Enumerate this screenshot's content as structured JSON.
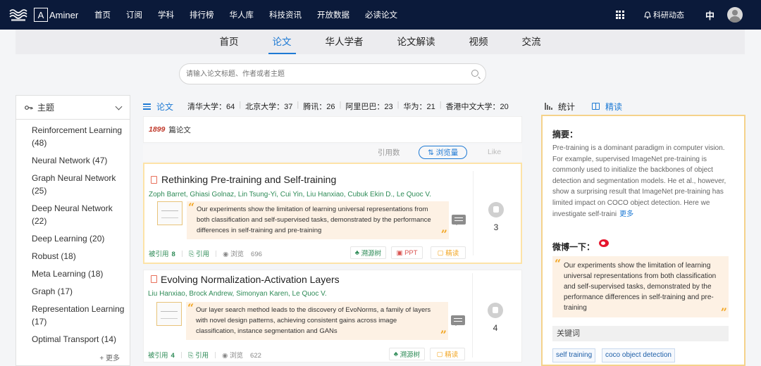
{
  "top": {
    "brand": "Aminer",
    "brand_letter": "A",
    "nav": [
      "首页",
      "订阅",
      "学科",
      "排行榜",
      "华人库",
      "科技资讯",
      "开放数据",
      "必读论文"
    ],
    "research_updates": "科研动态",
    "lang": "中"
  },
  "subnav": [
    "首页",
    "论文",
    "华人学者",
    "论文解读",
    "视频",
    "交流"
  ],
  "subnav_active": "论文",
  "search": {
    "placeholder": "请输入论文标题、作者或者主题"
  },
  "sidebar": {
    "header": "主题",
    "topics": [
      "Reinforcement Learning (48)",
      "Neural Network (47)",
      "Graph Neural Network (25)",
      "Deep Neural Network (22)",
      "Deep Learning (20)",
      "Robust (18)",
      "Meta Learning (18)",
      "Graph (17)",
      "Representation Learning (17)",
      "Optimal Transport (14)"
    ],
    "more": "+ 更多"
  },
  "center": {
    "tab": "论文",
    "institutions": [
      "清华大学：64",
      "北京大学：37",
      "腾讯：26",
      "阿里巴巴：23",
      "华为：21",
      "香港中文大学：20"
    ],
    "count_num": "1899",
    "count_label": "篇论文",
    "sort": {
      "citations": "引用数",
      "views": "⇅ 浏览量",
      "like": "Like"
    }
  },
  "papers": [
    {
      "title": "Rethinking Pre-training and Self-training",
      "authors": "Zoph Barret,  Ghiasi Golnaz,  Lin Tsung-Yi,  Cui Yin,  Liu Hanxiao,  Cubuk Ekin D.,  Le Quoc V.",
      "abstract": "Our experiments show the limitation of learning universal representations from both classification and self-supervised tasks, demonstrated by the performance differences in self-training and pre-training",
      "likes": "3",
      "cited_label": "被引用",
      "cited": "8",
      "cite_btn": "引用",
      "views_label": "浏览",
      "views": "696",
      "btn_tree": "溯源树",
      "btn_ppt": "PPT",
      "btn_read": "精读"
    },
    {
      "title": "Evolving Normalization-Activation Layers",
      "authors": "Liu Hanxiao,  Brock Andrew,  Simonyan Karen,  Le Quoc V.",
      "abstract": "Our layer search method leads to the discovery of EvoNorms, a family of layers with novel design patterns, achieving consistent gains across image classification, instance segmentation and GANs",
      "likes": "4",
      "cited_label": "被引用",
      "cited": "4",
      "cite_btn": "引用",
      "views_label": "浏览",
      "views": "622",
      "btn_tree": "溯源树",
      "btn_read": "精读"
    }
  ],
  "right": {
    "tab_stats": "统计",
    "tab_read": "精读",
    "abstract_title": "摘要：",
    "abstract": "Pre-training is a dominant paradigm in computer vision. For example, supervised ImageNet pre-training is commonly used to initialize the backbones of object detection and segmentation models. He et al., however, show a surprising result that ImageNet pre-training has limited impact on COCO object detection. Here we investigate self-traini",
    "abstract_more": "更多",
    "weibo_title": "微博一下：",
    "weibo_quote": "Our experiments show the limitation of learning universal representations from both classification and self-supervised tasks, demonstrated by the performance differences in self-training and pre-training",
    "keywords_title": "关键词",
    "keywords": [
      "self training",
      "coco object detection"
    ]
  }
}
